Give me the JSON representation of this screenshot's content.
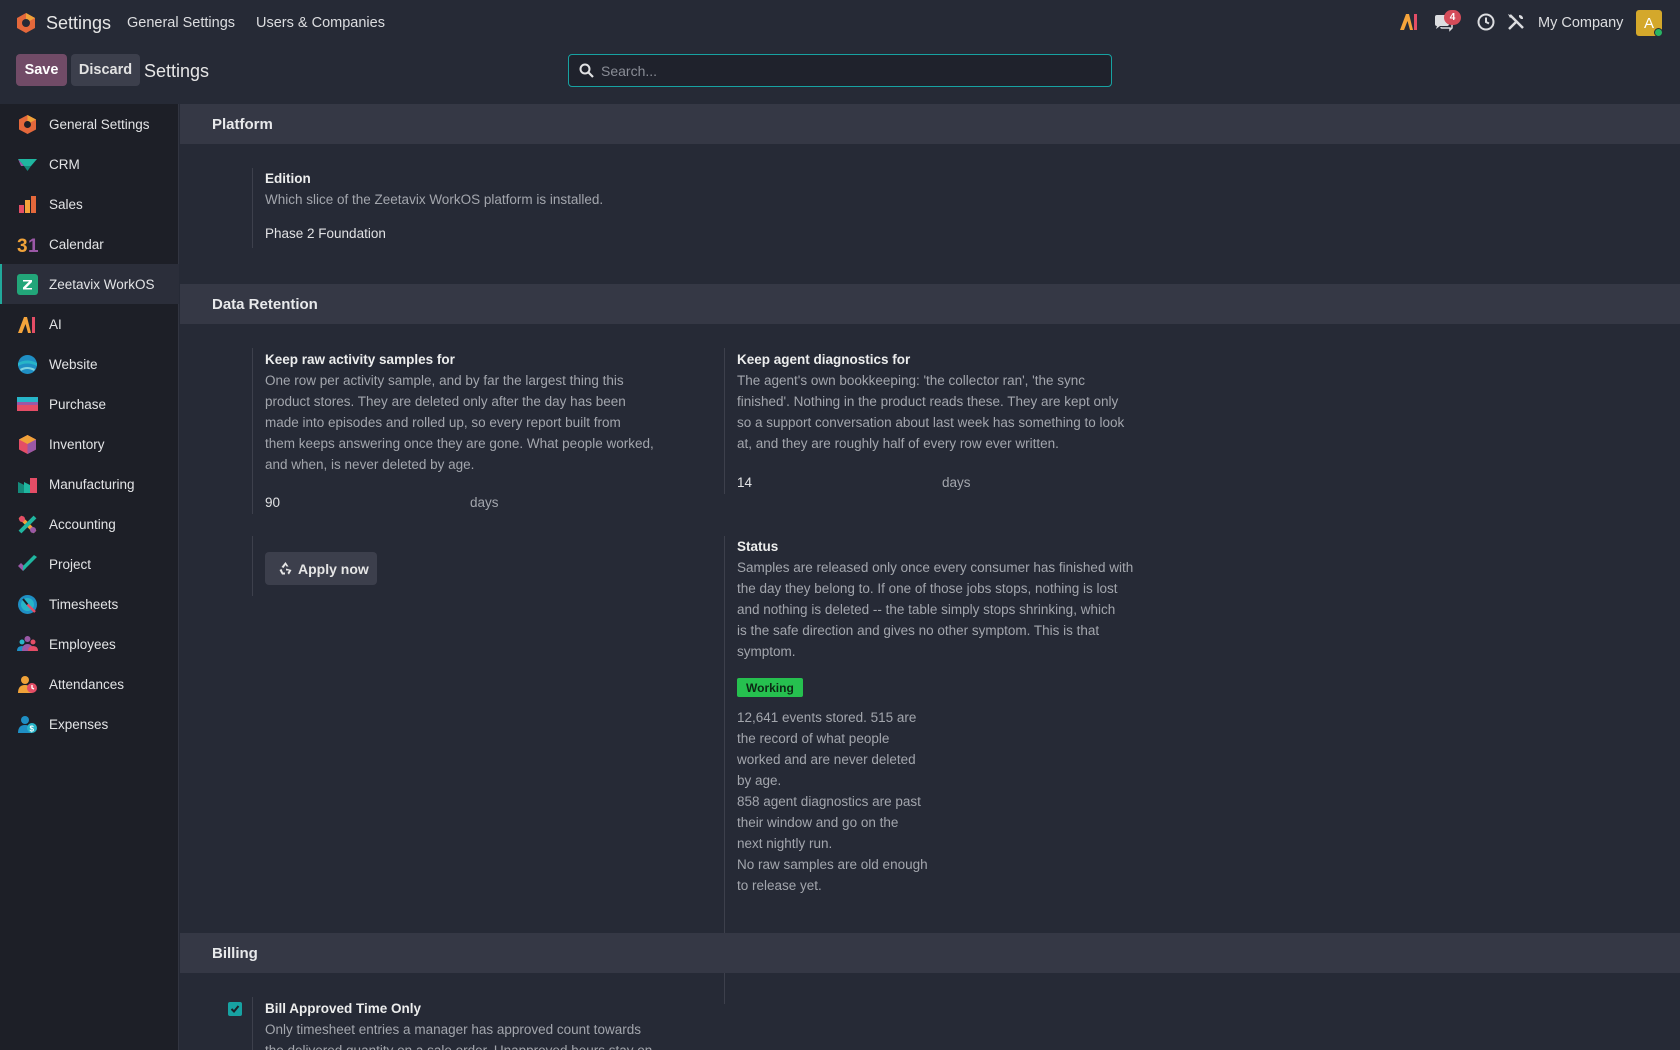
{
  "navbar": {
    "app_name": "Settings",
    "menu": [
      "General Settings",
      "Users & Companies"
    ],
    "chat_count": "4",
    "company": "My Company",
    "avatar_letter": "A"
  },
  "control": {
    "save_label": "Save",
    "discard_label": "Discard",
    "title": "Settings",
    "search_placeholder": "Search..."
  },
  "sidebar": {
    "items": [
      {
        "label": "General Settings",
        "icon": "general-settings-icon"
      },
      {
        "label": "CRM",
        "icon": "crm-icon"
      },
      {
        "label": "Sales",
        "icon": "sales-icon"
      },
      {
        "label": "Calendar",
        "icon": "calendar-icon"
      },
      {
        "label": "Zeetavix WorkOS",
        "icon": "zeetavix-icon",
        "active": true
      },
      {
        "label": "AI",
        "icon": "ai-icon"
      },
      {
        "label": "Website",
        "icon": "website-icon"
      },
      {
        "label": "Purchase",
        "icon": "purchase-icon"
      },
      {
        "label": "Inventory",
        "icon": "inventory-icon"
      },
      {
        "label": "Manufacturing",
        "icon": "manufacturing-icon"
      },
      {
        "label": "Accounting",
        "icon": "accounting-icon"
      },
      {
        "label": "Project",
        "icon": "project-icon"
      },
      {
        "label": "Timesheets",
        "icon": "timesheets-icon"
      },
      {
        "label": "Employees",
        "icon": "employees-icon"
      },
      {
        "label": "Attendances",
        "icon": "attendances-icon"
      },
      {
        "label": "Expenses",
        "icon": "expenses-icon"
      }
    ]
  },
  "platform": {
    "header": "Platform",
    "edition_title": "Edition",
    "edition_desc": "Which slice of the Zeetavix WorkOS platform is installed.",
    "edition_value": "Phase 2 Foundation"
  },
  "retention": {
    "header": "Data Retention",
    "raw": {
      "title": "Keep raw activity samples for",
      "desc": [
        "One row per activity sample, and by far the largest thing this",
        "product stores. They are deleted only after the day has been",
        "made into episodes and rolled up, so every report built from",
        "them keeps answering once they are gone. What people worked,",
        "and when, is never deleted by age."
      ],
      "value": "90",
      "unit": "days"
    },
    "diag": {
      "title": "Keep agent diagnostics for",
      "desc": [
        "The agent's own bookkeeping: 'the collector ran', 'the sync",
        "finished'. Nothing in the product reads these. They are kept only",
        "so a support conversation about last week has something to look",
        "at, and they are roughly half of every row ever written."
      ],
      "value": "14",
      "unit": "days"
    },
    "apply_label": "Apply now",
    "status": {
      "title": "Status",
      "desc": [
        "Samples are released only once every consumer has finished with",
        "the day they belong to. If one of those jobs stops, nothing is lost",
        "and nothing is deleted -- the table simply stops shrinking, which",
        "is the safe direction and gives no other symptom. This is that",
        "symptom."
      ],
      "badge": "Working",
      "details": [
        "12,641 events stored. 515 are",
        "the record of what people",
        "worked and are never deleted",
        "by age.",
        "858 agent diagnostics are past",
        "their window and go on the",
        "next nightly run.",
        "No raw samples are old enough",
        "to release yet."
      ]
    }
  },
  "billing": {
    "header": "Billing",
    "title": "Bill Approved Time Only",
    "desc": [
      "Only timesheet entries a manager has approved count towards",
      "the delivered quantity on a sale order. Unapproved hours stay on"
    ],
    "checked": true
  },
  "colors": {
    "accent": "#17a2a2",
    "save": "#714b67",
    "badge_green": "#26c04f"
  }
}
